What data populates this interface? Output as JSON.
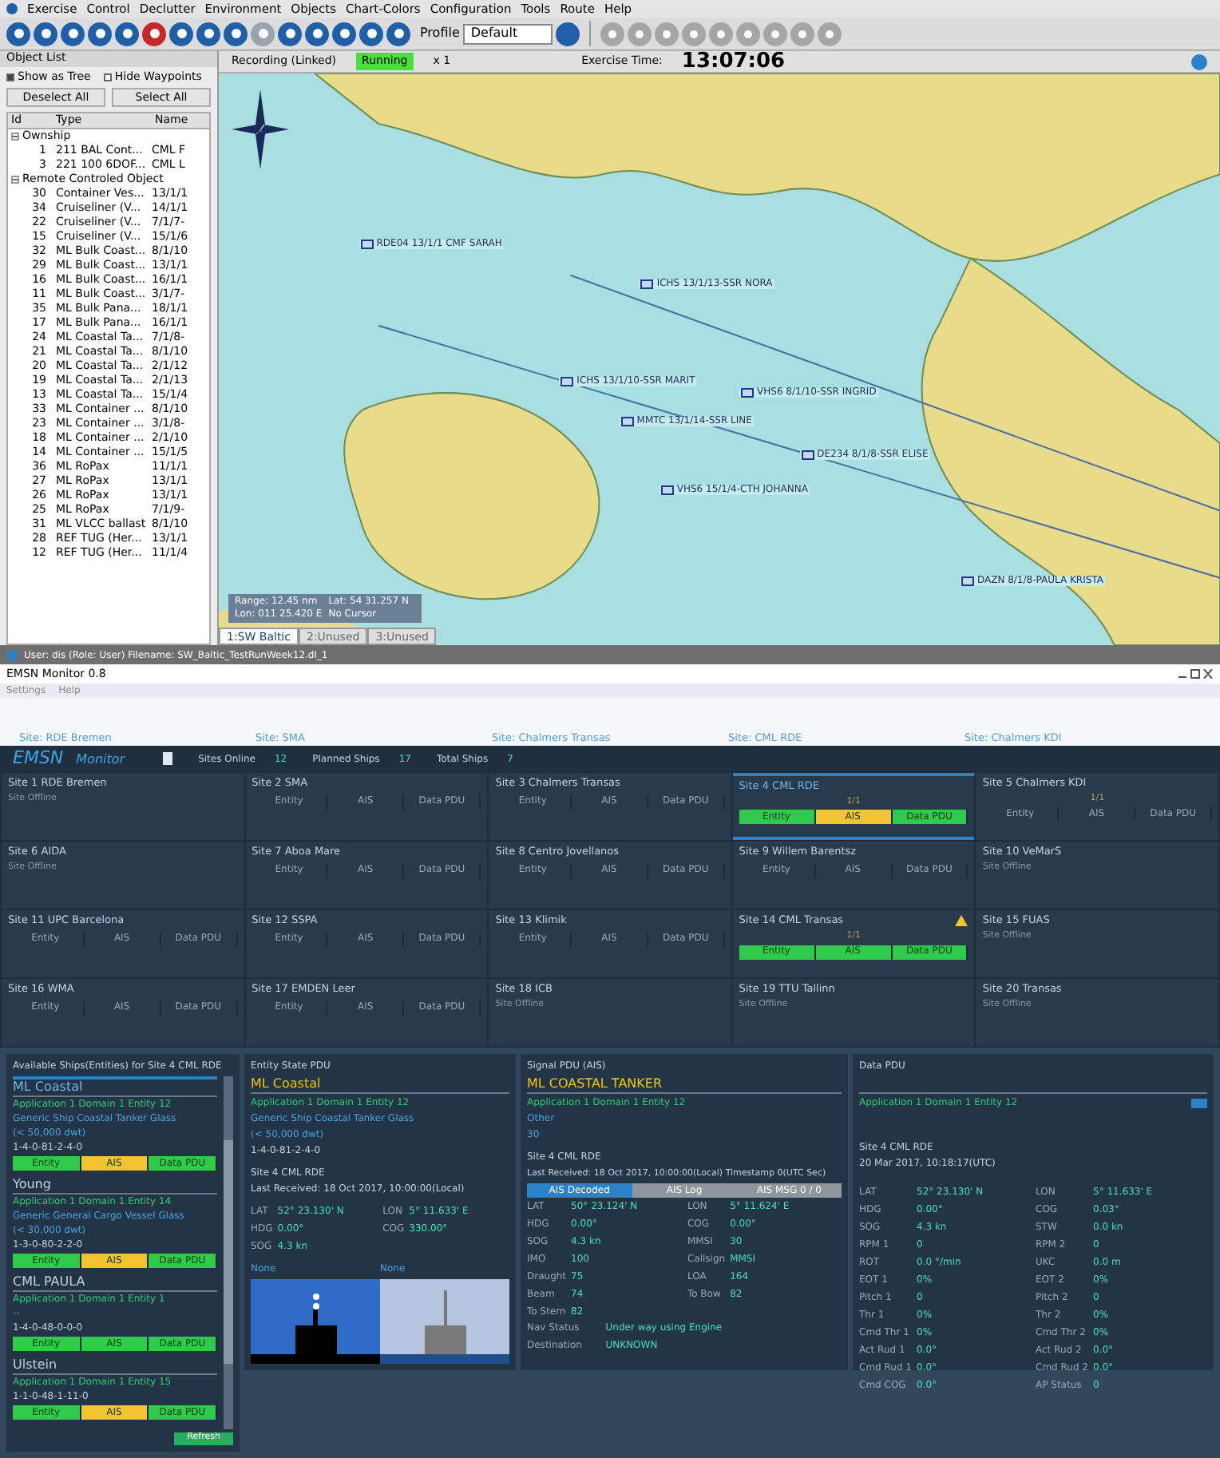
{
  "menu": [
    "Exercise",
    "Control",
    "Declutter",
    "Environment",
    "Objects",
    "Chart-Colors",
    "Configuration",
    "Tools",
    "Route",
    "Help"
  ],
  "toolbar": {
    "profile_label": "Profile",
    "profile_value": "Default"
  },
  "object_list": {
    "title": "Object List",
    "show_as_tree": true,
    "show_as_tree_label": "Show as Tree",
    "hide_waypoints": false,
    "hide_waypoints_label": "Hide Waypoints",
    "buttons": [
      "Deselect All",
      "Select All"
    ],
    "columns": [
      "Id",
      "Type",
      "Name"
    ],
    "groups": [
      {
        "label": "Ownship",
        "expanded": true,
        "children": [
          {
            "id": "1",
            "type": "211 BAL Cont...",
            "name": "CML F"
          },
          {
            "id": "3",
            "type": "221 100 6DOF...",
            "name": "CML L"
          }
        ]
      },
      {
        "label": "Remote Controled Object",
        "expanded": true,
        "children": [
          {
            "id": "30",
            "type": "Container Ves...",
            "name": "13/1/1"
          },
          {
            "id": "34",
            "type": "Cruiseliner (V...",
            "name": "14/1/1"
          },
          {
            "id": "22",
            "type": "Cruiseliner (V...",
            "name": "7/1/7-"
          },
          {
            "id": "15",
            "type": "Cruiseliner (V...",
            "name": "15/1/6"
          },
          {
            "id": "32",
            "type": "ML Bulk Coast...",
            "name": "8/1/10"
          },
          {
            "id": "29",
            "type": "ML Bulk Coast...",
            "name": "13/1/1"
          },
          {
            "id": "16",
            "type": "ML Bulk Coast...",
            "name": "16/1/1"
          },
          {
            "id": "11",
            "type": "ML Bulk Coast...",
            "name": "3/1/7-"
          },
          {
            "id": "35",
            "type": "ML Bulk Pana...",
            "name": "18/1/1"
          },
          {
            "id": "17",
            "type": "ML Bulk Pana...",
            "name": "16/1/1"
          },
          {
            "id": "24",
            "type": "ML Coastal Ta...",
            "name": "7/1/8-"
          },
          {
            "id": "21",
            "type": "ML Coastal Ta...",
            "name": "8/1/10"
          },
          {
            "id": "20",
            "type": "ML Coastal Ta...",
            "name": "2/1/12"
          },
          {
            "id": "19",
            "type": "ML Coastal Ta...",
            "name": "2/1/13"
          },
          {
            "id": "13",
            "type": "ML Coastal Ta...",
            "name": "15/1/4"
          },
          {
            "id": "33",
            "type": "ML Container ...",
            "name": "8/1/10"
          },
          {
            "id": "23",
            "type": "ML Container ...",
            "name": "3/1/8-"
          },
          {
            "id": "18",
            "type": "ML Container ...",
            "name": "2/1/10"
          },
          {
            "id": "14",
            "type": "ML Container ...",
            "name": "15/1/5"
          },
          {
            "id": "36",
            "type": "ML RoPax",
            "name": "11/1/1"
          },
          {
            "id": "27",
            "type": "ML RoPax",
            "name": "13/1/1"
          },
          {
            "id": "26",
            "type": "ML RoPax",
            "name": "13/1/1"
          },
          {
            "id": "25",
            "type": "ML RoPax",
            "name": "7/1/9-"
          },
          {
            "id": "31",
            "type": "ML VLCC ballast",
            "name": "8/1/10"
          },
          {
            "id": "28",
            "type": "REF TUG (Her...",
            "name": "13/1/1"
          },
          {
            "id": "12",
            "type": "REF TUG (Her...",
            "name": "11/1/4"
          }
        ]
      }
    ]
  },
  "sim_bar": {
    "mode": "Recording (Linked)",
    "state": "Running",
    "running": true,
    "speed": "x 1",
    "time_label": "Exercise Time:",
    "time": "13:07:06"
  },
  "map": {
    "labels": [
      {
        "text": "RDE04 13/1/1 CMF SARAH"
      },
      {
        "text": "ICHS 13/1/13-SSR NORA"
      },
      {
        "text": "ICHS 13/1/10-SSR MARIT"
      },
      {
        "text": "VHS6 8/1/10-SSR INGRID"
      },
      {
        "text": "MMTC 13/1/14-SSR LINE"
      },
      {
        "text": "DE234 8/1/8-SSR ELISE"
      },
      {
        "text": "VHS6 15/1/4-CTH JOHANNA"
      },
      {
        "text": "DAZN 8/1/8-PAULA KRISTA"
      }
    ],
    "info": [
      "Range: 12.45 nm",
      "Lat: 54 31.257 N",
      "Lon: 011 25.420 E",
      "No Cursor"
    ]
  },
  "chart_tabs": [
    {
      "label": "1:SW Baltic",
      "selected": true
    },
    {
      "label": "2:Unused",
      "selected": false
    },
    {
      "label": "3:Unused",
      "selected": false
    }
  ],
  "status_bar": "User: dis (Role: User) Filename: SW_Baltic_TestRunWeek12.dl_1",
  "monitor": {
    "title": "EMSN Monitor 0.8",
    "menu": [
      "Settings",
      "Help"
    ],
    "site_links": [
      "Site: RDE Bremen",
      "Site: SMA",
      "Site: Chalmers Transas",
      "Site: CML RDE",
      "Site: Chalmers KDI"
    ],
    "logo": [
      "EMSN",
      "Monitor"
    ],
    "stats": [
      {
        "label": "Sites Online",
        "value": "12"
      },
      {
        "label": "Planned Ships",
        "value": "17"
      },
      {
        "label": "Total Ships",
        "value": "7"
      }
    ],
    "sites": [
      {
        "name": "Site 1 RDE Bremen",
        "kind": "offline",
        "note": "Site Offline"
      },
      {
        "name": "Site 2 SMA",
        "kind": "idle",
        "segments": [
          {
            "label": "Entity"
          },
          {
            "label": "AIS"
          },
          {
            "label": "Data PDU"
          }
        ]
      },
      {
        "name": "Site 3 Chalmers Transas",
        "kind": "idle",
        "segments": [
          {
            "label": "Entity"
          },
          {
            "label": "AIS"
          },
          {
            "label": "Data PDU"
          }
        ]
      },
      {
        "name": "Site 4 CML RDE",
        "kind": "active",
        "selected": true,
        "warning": false,
        "count": "1/1",
        "segments": [
          {
            "label": "Entity",
            "color": "#2ecc4a"
          },
          {
            "label": "AIS",
            "color": "#f4c430"
          },
          {
            "label": "Data PDU",
            "color": "#2ecc4a"
          }
        ]
      },
      {
        "name": "Site 5 Chalmers KDI",
        "kind": "idle",
        "count": "1/1",
        "segments": [
          {
            "label": "Entity"
          },
          {
            "label": "AIS"
          },
          {
            "label": "Data PDU"
          }
        ]
      },
      {
        "name": "Site 6 AIDA",
        "kind": "offline",
        "note": "Site Offline"
      },
      {
        "name": "Site 7 Aboa Mare",
        "kind": "idle",
        "segments": [
          {
            "label": "Entity"
          },
          {
            "label": "AIS"
          },
          {
            "label": "Data PDU"
          }
        ]
      },
      {
        "name": "Site 8 Centro Jovellanos",
        "kind": "idle",
        "segments": [
          {
            "label": "Entity"
          },
          {
            "label": "AIS"
          },
          {
            "label": "Data PDU"
          }
        ]
      },
      {
        "name": "Site 9 Willem Barentsz",
        "kind": "idle",
        "segments": [
          {
            "label": "Entity"
          },
          {
            "label": "AIS"
          },
          {
            "label": "Data PDU"
          }
        ]
      },
      {
        "name": "Site 10 VeMarS",
        "kind": "offline",
        "note": "Site Offline"
      },
      {
        "name": "Site 11 UPC Barcelona",
        "kind": "idle",
        "segments": [
          {
            "label": "Entity"
          },
          {
            "label": "AIS"
          },
          {
            "label": "Data PDU"
          }
        ]
      },
      {
        "name": "Site 12 SSPA",
        "kind": "idle",
        "segments": [
          {
            "label": "Entity"
          },
          {
            "label": "AIS"
          },
          {
            "label": "Data PDU"
          }
        ]
      },
      {
        "name": "Site 13 Klimik",
        "kind": "idle",
        "segments": [
          {
            "label": "Entity"
          },
          {
            "label": "AIS"
          },
          {
            "label": "Data PDU"
          }
        ]
      },
      {
        "name": "Site 14 CML Transas",
        "kind": "active",
        "selected": false,
        "warning": true,
        "count": "1/1",
        "segments": [
          {
            "label": "Entity",
            "color": "#2ecc4a"
          },
          {
            "label": "AIS",
            "color": "#2ecc4a"
          },
          {
            "label": "Data PDU",
            "color": "#2ecc4a"
          }
        ]
      },
      {
        "name": "Site 15 FUAS",
        "kind": "offline",
        "note": "Site Offline"
      },
      {
        "name": "Site 16 WMA",
        "kind": "idle",
        "segments": [
          {
            "label": "Entity"
          },
          {
            "label": "AIS"
          },
          {
            "label": "Data PDU"
          }
        ]
      },
      {
        "name": "Site 17 EMDEN Leer",
        "kind": "idle",
        "segments": [
          {
            "label": "Entity"
          },
          {
            "label": "AIS"
          },
          {
            "label": "Data PDU"
          }
        ]
      },
      {
        "name": "Site 18 ICB",
        "kind": "offline",
        "note": "Site Offline"
      },
      {
        "name": "Site 19 TTU Tallinn",
        "kind": "offline",
        "note": "Site Offline"
      },
      {
        "name": "Site 20 Transas",
        "kind": "offline",
        "note": "Site Offline"
      }
    ],
    "ships_panel": {
      "title": "Available Ships(Entities) for Site 4 CML RDE",
      "refresh": "Refresh",
      "ships": [
        {
          "name": "ML Coastal",
          "selected": true,
          "app": "Application 1 Domain 1 Entity 12",
          "desc": [
            "Generic Ship Coastal Tanker Glass",
            "(< 50,000 dwt)"
          ],
          "code": "1-4-0-81-2-4-0",
          "segments": [
            {
              "label": "Entity",
              "color": "#2ecc4a"
            },
            {
              "label": "AIS",
              "color": "#f4c430"
            },
            {
              "label": "Data PDU",
              "color": "#2ecc4a"
            }
          ]
        },
        {
          "name": "Young",
          "selected": false,
          "app": "Application 1 Domain 1 Entity 14",
          "desc": [
            "Generic General Cargo Vessel Glass",
            "(< 30,000 dwt)"
          ],
          "code": "1-3-0-80-2-2-0",
          "segments": [
            {
              "label": "Entity",
              "color": "#2ecc4a"
            },
            {
              "label": "AIS",
              "color": "#f4c430"
            },
            {
              "label": "Data PDU",
              "color": "#2ecc4a"
            }
          ]
        },
        {
          "name": "CML PAULA",
          "selected": false,
          "app": "Application 1 Domain 1 Entity 1",
          "desc": [
            "--"
          ],
          "code": "1-4-0-48-0-0-0",
          "segments": [
            {
              "label": "Entity",
              "color": "#2ecc4a"
            },
            {
              "label": "AIS",
              "color": "#2ecc4a"
            },
            {
              "label": "Data PDU",
              "color": "#2ecc4a"
            }
          ]
        },
        {
          "name": "Ulstein",
          "selected": false,
          "app": "Application 1 Domain 1 Entity 15",
          "code": "1-1-0-48-1-11-0",
          "segments": [
            {
              "label": "Entity",
              "color": "#2ecc4a"
            },
            {
              "label": "AIS",
              "color": "#f4c430"
            },
            {
              "label": "Data PDU",
              "color": "#2ecc4a"
            }
          ]
        }
      ]
    },
    "entity_panel": {
      "title": "Entity State PDU",
      "name": "ML Coastal",
      "app": "Application 1 Domain 1 Entity 12",
      "desc": [
        "Generic Ship Coastal Tanker Glass",
        "(< 50,000 dwt)"
      ],
      "code": "1-4-0-81-2-4-0",
      "site": "Site 4 CML RDE",
      "received": "Last Received: 18 Oct 2017, 10:00:00(Local)",
      "fields": [
        {
          "k": "LAT",
          "v": "52° 23.130' N"
        },
        {
          "k": "LON",
          "v": "5° 11.633' E"
        },
        {
          "k": "HDG",
          "v": "0.00°"
        },
        {
          "k": "COG",
          "v": "330.00°"
        },
        {
          "k": "SOG",
          "v": "4.3 kn"
        }
      ],
      "lights": [
        "None",
        "None"
      ]
    },
    "signal_panel": {
      "title": "Signal PDU (AIS)",
      "name": "ML COASTAL TANKER",
      "app": "Application 1 Domain 1 Entity 12",
      "extra": [
        "Other",
        "30"
      ],
      "site": "Site 4 CML RDE",
      "received": "Last Received: 18 Oct 2017, 10:00:00(Local) Timestamp 0(UTC Sec)",
      "tabs": [
        {
          "label": "AIS Decoded",
          "selected": true
        },
        {
          "label": "AIS Log",
          "selected": false
        },
        {
          "label": "AIS MSG 0 / 0",
          "selected": false
        }
      ],
      "fields": [
        {
          "k": "LAT",
          "v": "50° 23.124' N"
        },
        {
          "k": "LON",
          "v": "5° 11.624' E"
        },
        {
          "k": "HDG",
          "v": "0.00°"
        },
        {
          "k": "COG",
          "v": "0.00°"
        },
        {
          "k": "SOG",
          "v": "4.3 kn"
        },
        {
          "k": "MMSI",
          "v": "30"
        },
        {
          "k": "IMO",
          "v": "100"
        },
        {
          "k": "Callsign",
          "v": "MMSI"
        },
        {
          "k": "Draught",
          "v": "75"
        },
        {
          "k": "LOA",
          "v": "164"
        },
        {
          "k": "Beam",
          "v": "74"
        },
        {
          "k": "To Bow",
          "v": "82"
        },
        {
          "k": "To Stern",
          "v": "82"
        }
      ],
      "rows": [
        {
          "k": "Nav Status",
          "v": "Under way using Engine"
        },
        {
          "k": "Destination",
          "v": "UNKNOWN"
        }
      ]
    },
    "data_panel": {
      "title": "Data PDU",
      "app": "Application 1 Domain 1 Entity 12",
      "site": "Site 4 CML RDE",
      "received": "20 Mar 2017, 10:18:17(UTC)",
      "fields": [
        {
          "k": "LAT",
          "v": "52° 23.130' N"
        },
        {
          "k": "LON",
          "v": "5° 11.633' E"
        },
        {
          "k": "HDG",
          "v": "0.00°"
        },
        {
          "k": "COG",
          "v": "0.03°"
        },
        {
          "k": "SOG",
          "v": "4.3 kn"
        },
        {
          "k": "STW",
          "v": "0.0 kn"
        },
        {
          "k": "RPM 1",
          "v": "0"
        },
        {
          "k": "RPM 2",
          "v": "0"
        },
        {
          "k": "ROT",
          "v": "0.0 °/min"
        },
        {
          "k": "UKC",
          "v": "0.0 m"
        },
        {
          "k": "EOT 1",
          "v": "0%"
        },
        {
          "k": "EOT 2",
          "v": "0%"
        },
        {
          "k": "Pitch 1",
          "v": "0"
        },
        {
          "k": "Pitch 2",
          "v": "0"
        },
        {
          "k": "Thr 1",
          "v": "0%"
        },
        {
          "k": "Thr 2",
          "v": "0%"
        },
        {
          "k": "Cmd Thr 1",
          "v": "0%"
        },
        {
          "k": "Cmd Thr 2",
          "v": "0%"
        },
        {
          "k": "Act Rud 1",
          "v": "0.0°"
        },
        {
          "k": "Act Rud 2",
          "v": "0.0°"
        },
        {
          "k": "Cmd Rud 1",
          "v": "0.0°"
        },
        {
          "k": "Cmd Rud 2",
          "v": "0.0°"
        },
        {
          "k": "Cmd COG",
          "v": "0.0°"
        },
        {
          "k": "AP Status",
          "v": "0"
        }
      ]
    }
  }
}
